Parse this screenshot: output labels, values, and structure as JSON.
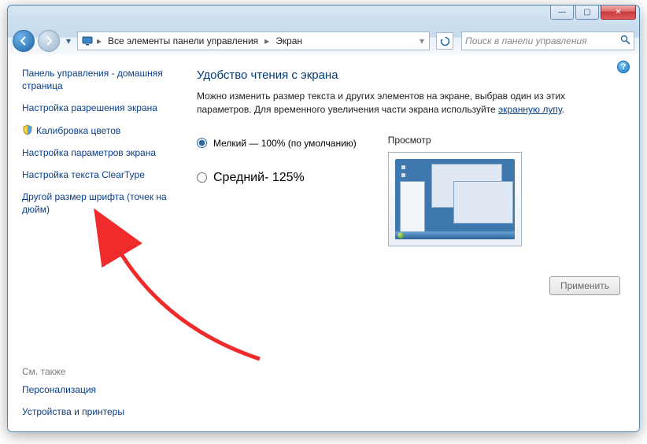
{
  "titlebar": {
    "min": "—",
    "max": "▢",
    "close": "✕"
  },
  "nav": {
    "breadcrumb_root": "Все элементы панели управления",
    "breadcrumb_current": "Экран",
    "search_placeholder": "Поиск в панели управления"
  },
  "sidebar": {
    "home": "Панель управления - домашняя страница",
    "items": [
      "Настройка разрешения экрана",
      "Калибровка цветов",
      "Настройка параметров экрана",
      "Настройка текста ClearType",
      "Другой размер шрифта (точек на дюйм)"
    ],
    "see_also_title": "См. также",
    "see_also": [
      "Персонализация",
      "Устройства и принтеры"
    ]
  },
  "content": {
    "title": "Удобство чтения с экрана",
    "desc_1": "Можно изменить размер текста и других элементов на экране, выбрав один из этих параметров. Для временного увеличения части экрана используйте ",
    "desc_link": "экранную лупу",
    "radio_small": "Мелкий — 100% (по умолчанию)",
    "radio_medium": "Средний- 125%",
    "preview_label": "Просмотр",
    "apply": "Применить"
  }
}
